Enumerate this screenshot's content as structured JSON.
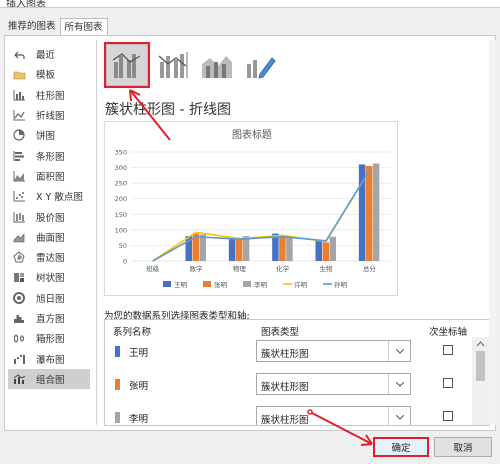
{
  "window": {
    "title": "插入图表"
  },
  "tabs": [
    {
      "label": "推荐的图表",
      "active": false
    },
    {
      "label": "所有图表",
      "active": true
    }
  ],
  "sidebar": {
    "items": [
      {
        "label": "最近",
        "icon": "undo-icon"
      },
      {
        "label": "模板",
        "icon": "folder-icon"
      },
      {
        "label": "柱形图",
        "icon": "column-chart-icon"
      },
      {
        "label": "折线图",
        "icon": "line-chart-icon"
      },
      {
        "label": "饼图",
        "icon": "pie-chart-icon"
      },
      {
        "label": "条形图",
        "icon": "bar-chart-icon"
      },
      {
        "label": "面积图",
        "icon": "area-chart-icon"
      },
      {
        "label": "X Y 散点图",
        "icon": "scatter-chart-icon"
      },
      {
        "label": "股价图",
        "icon": "stock-chart-icon"
      },
      {
        "label": "曲面图",
        "icon": "surface-chart-icon"
      },
      {
        "label": "雷达图",
        "icon": "radar-chart-icon"
      },
      {
        "label": "树状图",
        "icon": "treemap-icon"
      },
      {
        "label": "旭日图",
        "icon": "sunburst-icon"
      },
      {
        "label": "直方图",
        "icon": "histogram-icon"
      },
      {
        "label": "箱形图",
        "icon": "box-plot-icon"
      },
      {
        "label": "瀑布图",
        "icon": "waterfall-icon"
      },
      {
        "label": "组合图",
        "icon": "combo-chart-icon",
        "active": true
      }
    ]
  },
  "combo_types": [
    {
      "name": "clustered-column-line",
      "selected": true
    },
    {
      "name": "clustered-column-line-secondary-axis",
      "selected": false
    },
    {
      "name": "stacked-area-clustered-column",
      "selected": false
    },
    {
      "name": "custom-combination",
      "selected": false
    }
  ],
  "heading": "簇状柱形图 - 折线图",
  "chart_data": {
    "type": "bar",
    "title": "图表标题",
    "categories": [
      "班级",
      "数学",
      "物理",
      "化学",
      "生物",
      "总分"
    ],
    "ylim": [
      0,
      350
    ],
    "yticks": [
      "0",
      "50",
      "100",
      "150",
      "200",
      "250",
      "300",
      "350"
    ],
    "series": [
      {
        "name": "王明",
        "values": [
          0,
          80,
          72,
          88,
          68,
          310
        ],
        "color": "#4472c4"
      },
      {
        "name": "张明",
        "values": [
          0,
          88,
          75,
          78,
          60,
          305
        ],
        "color": "#ed7d31"
      },
      {
        "name": "李明",
        "values": [
          0,
          85,
          80,
          80,
          78,
          313
        ],
        "color": "#a5a5a5"
      }
    ],
    "lines": [
      {
        "name": "许明",
        "values": [
          0,
          92,
          72,
          82,
          62,
          290
        ],
        "color": "#ffc000"
      },
      {
        "name": "孙明",
        "values": [
          0,
          78,
          70,
          78,
          65,
          290
        ],
        "color": "#5b9bd5"
      }
    ],
    "legend": "bottom"
  },
  "prompt": "为您的数据系列选择图表类型和轴:",
  "table": {
    "headers": {
      "name": "系列名称",
      "type": "图表类型",
      "secondary": "次坐标轴"
    },
    "rows": [
      {
        "name": "王明",
        "color": "#4472c4",
        "type": "簇状柱形图",
        "secondary": false
      },
      {
        "name": "张明",
        "color": "#ed7d31",
        "type": "簇状柱形图",
        "secondary": false
      },
      {
        "name": "李明",
        "color": "#a5a5a5",
        "type": "簇状柱形图",
        "secondary": false
      }
    ]
  },
  "buttons": {
    "ok": "确定",
    "cancel": "取消"
  }
}
